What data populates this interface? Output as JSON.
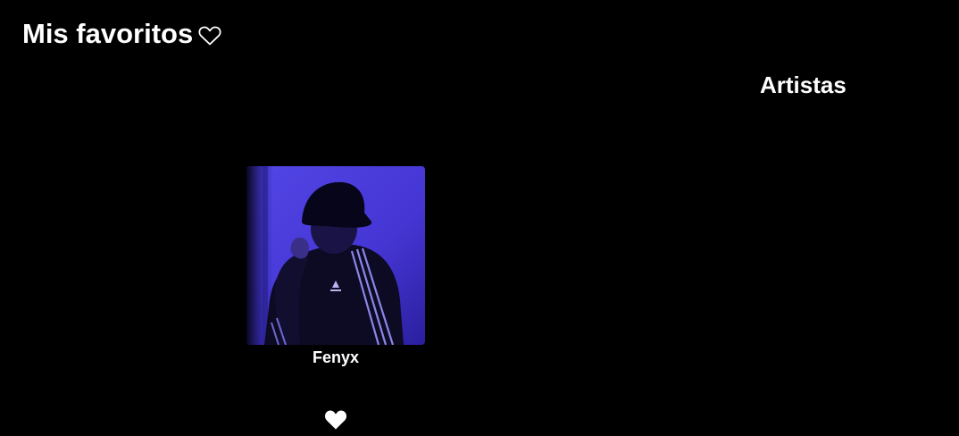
{
  "page": {
    "title": "Mis favoritos",
    "title_icon": "heart-outline-icon"
  },
  "sections": {
    "artists_title": "Artistas"
  },
  "artists": [
    {
      "name": "Fenyx",
      "favorite_icon": "heart-filled-icon",
      "favorited": true
    }
  ],
  "colors": {
    "background": "#000000",
    "text": "#ffffff",
    "photo_tint": "#4a3fd9"
  }
}
